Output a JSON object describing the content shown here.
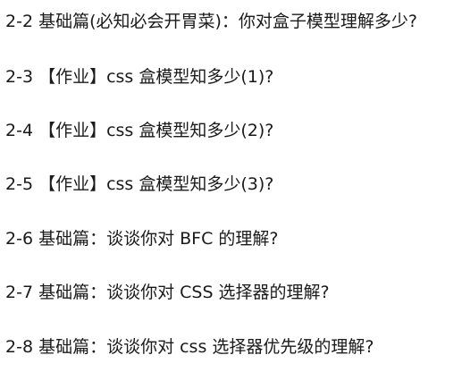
{
  "lessons": [
    "2-2 基础篇(必知必会开胃菜)：你对盒子模型理解多少?",
    "2-3 【作业】css 盒模型知多少(1)?",
    "2-4 【作业】css 盒模型知多少(2)?",
    "2-5 【作业】css 盒模型知多少(3)?",
    "2-6 基础篇：谈谈你对 BFC 的理解?",
    "2-7 基础篇：谈谈你对 CSS 选择器的理解?",
    "2-8 基础篇：谈谈你对 css 选择器优先级的理解?"
  ]
}
